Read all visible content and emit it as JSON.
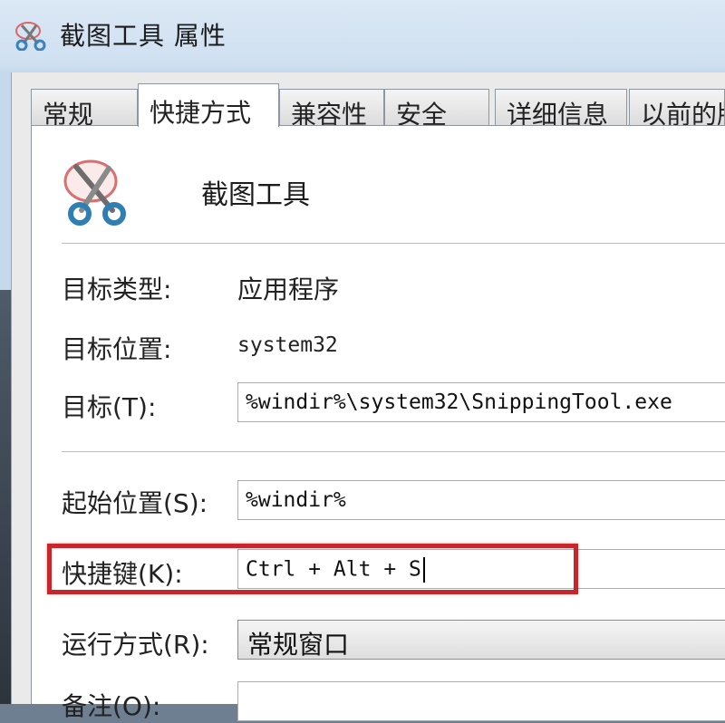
{
  "window": {
    "title": "截图工具 属性",
    "title_icon": "scissors-icon"
  },
  "tabs": [
    {
      "label": "常规",
      "active": false
    },
    {
      "label": "快捷方式",
      "active": true
    },
    {
      "label": "兼容性",
      "active": false
    },
    {
      "label": "安全",
      "active": false
    },
    {
      "label": "详细信息",
      "active": false
    },
    {
      "label": "以前的版",
      "active": false
    }
  ],
  "shortcut": {
    "app_icon": "snipping-tool-icon",
    "app_name": "截图工具",
    "target_type_label": "目标类型:",
    "target_type_value": "应用程序",
    "target_location_label": "目标位置:",
    "target_location_value": "system32",
    "target_label": "目标(T):",
    "target_value": "%windir%\\system32\\SnippingTool.exe",
    "start_in_label": "起始位置(S):",
    "start_in_value": "%windir%",
    "hotkey_label": "快捷键(K):",
    "hotkey_value": "Ctrl + Alt + S",
    "run_label": "运行方式(R):",
    "run_value": "常规窗口",
    "comment_label": "备注(O):"
  },
  "colors": {
    "highlight": "#c9252b"
  }
}
